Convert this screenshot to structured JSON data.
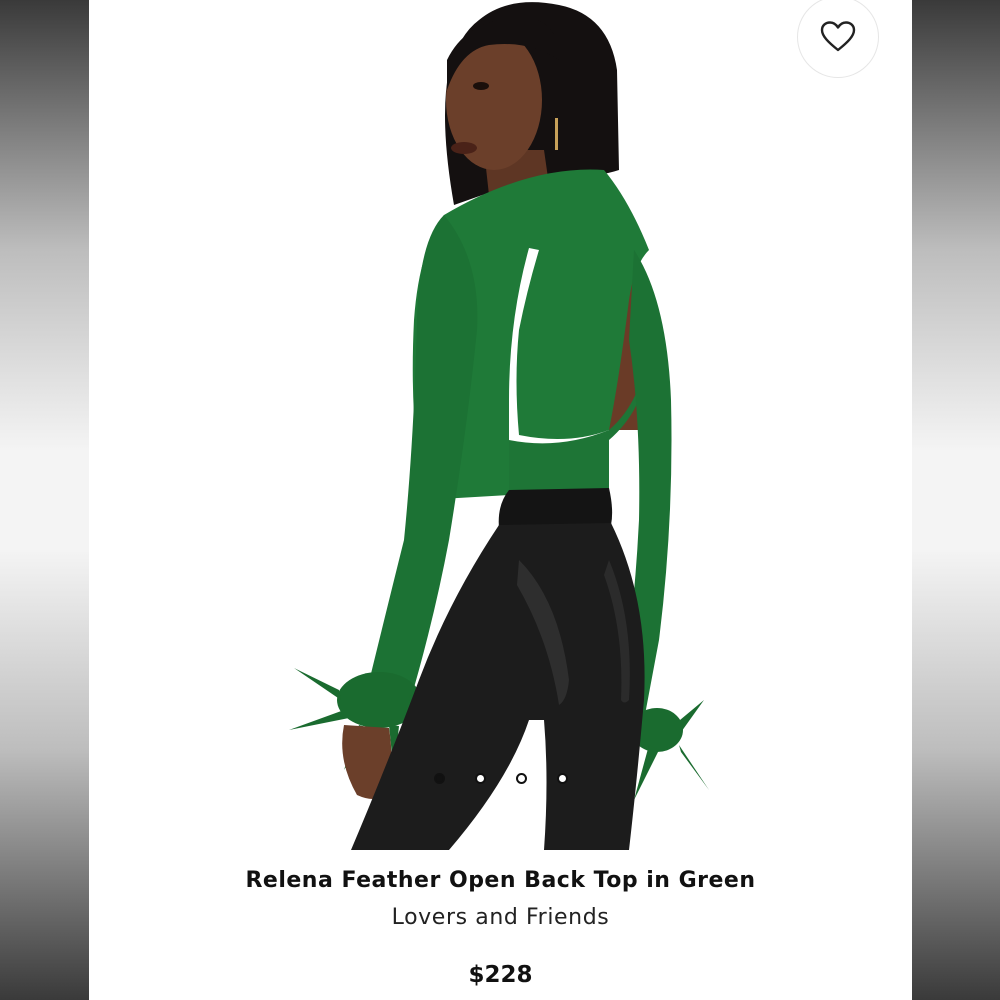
{
  "product": {
    "title": "Relena Feather Open Back Top in Green",
    "brand": "Lovers and Friends",
    "price": "$228"
  },
  "gallery": {
    "image_count": 4,
    "active_index": 0
  },
  "icons": {
    "favorite": "heart-outline-icon"
  },
  "colors": {
    "sweater_green": "#1f7a38",
    "leggings": "#1c1c1c",
    "skin": "#6b3f2a",
    "hair": "#141010"
  }
}
